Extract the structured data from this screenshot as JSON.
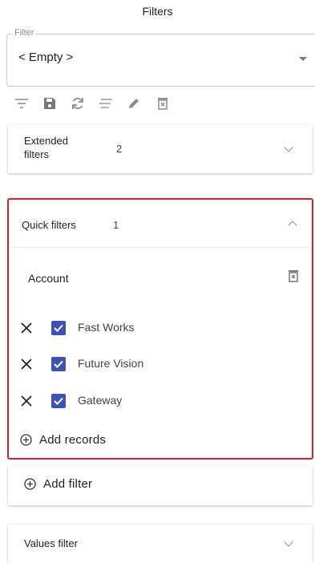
{
  "header": {
    "title": "Filters"
  },
  "filter": {
    "legend": "Filter",
    "value": "< Empty >"
  },
  "toolbar": {
    "icons": [
      "filter-lines-icon",
      "save-icon",
      "refresh-icon",
      "list-icon",
      "pencil-icon",
      "delete-icon"
    ]
  },
  "extended": {
    "label_line1": "Extended",
    "label_line2": "filters",
    "count": "2"
  },
  "quick": {
    "label": "Quick filters",
    "count": "1",
    "group": "Account",
    "items": [
      {
        "label": "Fast Works",
        "checked": true
      },
      {
        "label": "Future Vision",
        "checked": true
      },
      {
        "label": "Gateway",
        "checked": true
      }
    ],
    "add_records": "Add records"
  },
  "add_filter": {
    "label": "Add filter"
  },
  "values_filter": {
    "label": "Values filter"
  },
  "colors": {
    "highlight": "#d2232a",
    "checkbox": "#3f51b5"
  }
}
